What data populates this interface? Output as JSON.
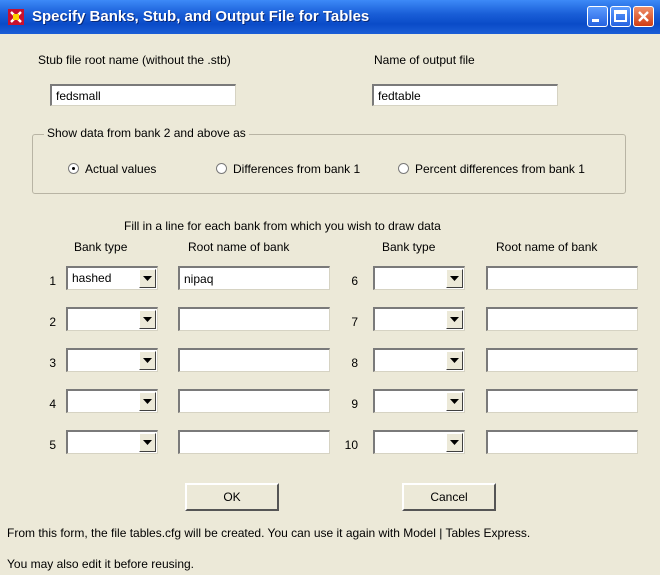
{
  "window": {
    "title": "Specify Banks, Stub, and Output File for Tables",
    "buttons": {
      "minimize": "minimize-icon",
      "maximize": "maximize-icon",
      "close": "close-icon"
    }
  },
  "stub": {
    "label": "Stub file root name (without the .stb)",
    "value": "fedsmall"
  },
  "output": {
    "label": "Name of output file",
    "value": "fedtable"
  },
  "show_data": {
    "title": "Show data from bank 2 and above as",
    "options": [
      "Actual values",
      "Differences from bank 1",
      "Percent differences from bank 1"
    ],
    "selected": "Actual values"
  },
  "banks": {
    "instruction": "Fill in a line for each bank from which you wish to draw data",
    "col_type": "Bank type",
    "col_root": "Root name of bank",
    "rows": [
      {
        "num": "1",
        "type": "hashed",
        "root": "nipaq"
      },
      {
        "num": "2",
        "type": "",
        "root": ""
      },
      {
        "num": "3",
        "type": "",
        "root": ""
      },
      {
        "num": "4",
        "type": "",
        "root": ""
      },
      {
        "num": "5",
        "type": "",
        "root": ""
      },
      {
        "num": "6",
        "type": "",
        "root": ""
      },
      {
        "num": "7",
        "type": "",
        "root": ""
      },
      {
        "num": "8",
        "type": "",
        "root": ""
      },
      {
        "num": "9",
        "type": "",
        "root": ""
      },
      {
        "num": "10",
        "type": "",
        "root": ""
      }
    ]
  },
  "actions": {
    "ok": "OK",
    "cancel": "Cancel"
  },
  "footer": {
    "line1": "From this form, the file tables.cfg will be created.  You can use it again with Model | Tables Express.",
    "line2": "You may also edit it before reusing."
  },
  "colors": {
    "titlebar": "#0a4bc8",
    "dialog_bg": "#ece9d8",
    "close_button": "#cf3c14"
  }
}
